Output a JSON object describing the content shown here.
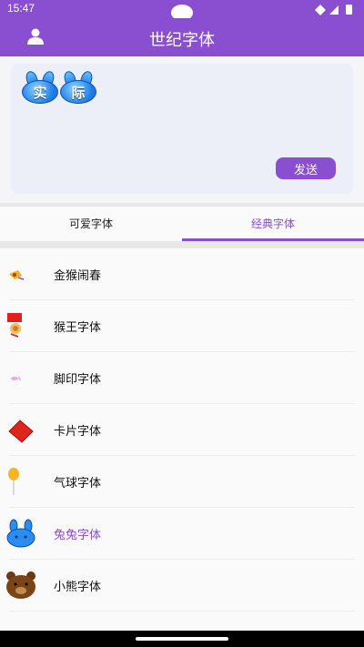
{
  "status_bar": {
    "time": "15:47"
  },
  "app_bar": {
    "title": "世纪字体",
    "user_icon": "user-icon"
  },
  "composer": {
    "preview_chars": [
      "实",
      "际"
    ],
    "preview_style": "bunny-font",
    "send_label": "发送"
  },
  "tabs": [
    {
      "label": "可爱字体",
      "selected": false
    },
    {
      "label": "经典字体",
      "selected": true
    }
  ],
  "font_list": [
    {
      "label": "金猴闹春",
      "icon": "monkey-sticker-icon",
      "selected": false
    },
    {
      "label": "猴王字体",
      "icon": "monkey-king-icon",
      "selected": false
    },
    {
      "label": "脚印字体",
      "icon": "footprint-icon",
      "selected": false
    },
    {
      "label": "卡片字体",
      "icon": "red-card-icon",
      "selected": false
    },
    {
      "label": "气球字体",
      "icon": "balloon-icon",
      "selected": false
    },
    {
      "label": "兔兔字体",
      "icon": "bunny-icon",
      "selected": true
    },
    {
      "label": "小熊字体",
      "icon": "bear-icon",
      "selected": false
    }
  ],
  "colors": {
    "accent": "#8a4fd0",
    "background": "#f5f5f7",
    "composer_bg": "#eceef8"
  }
}
